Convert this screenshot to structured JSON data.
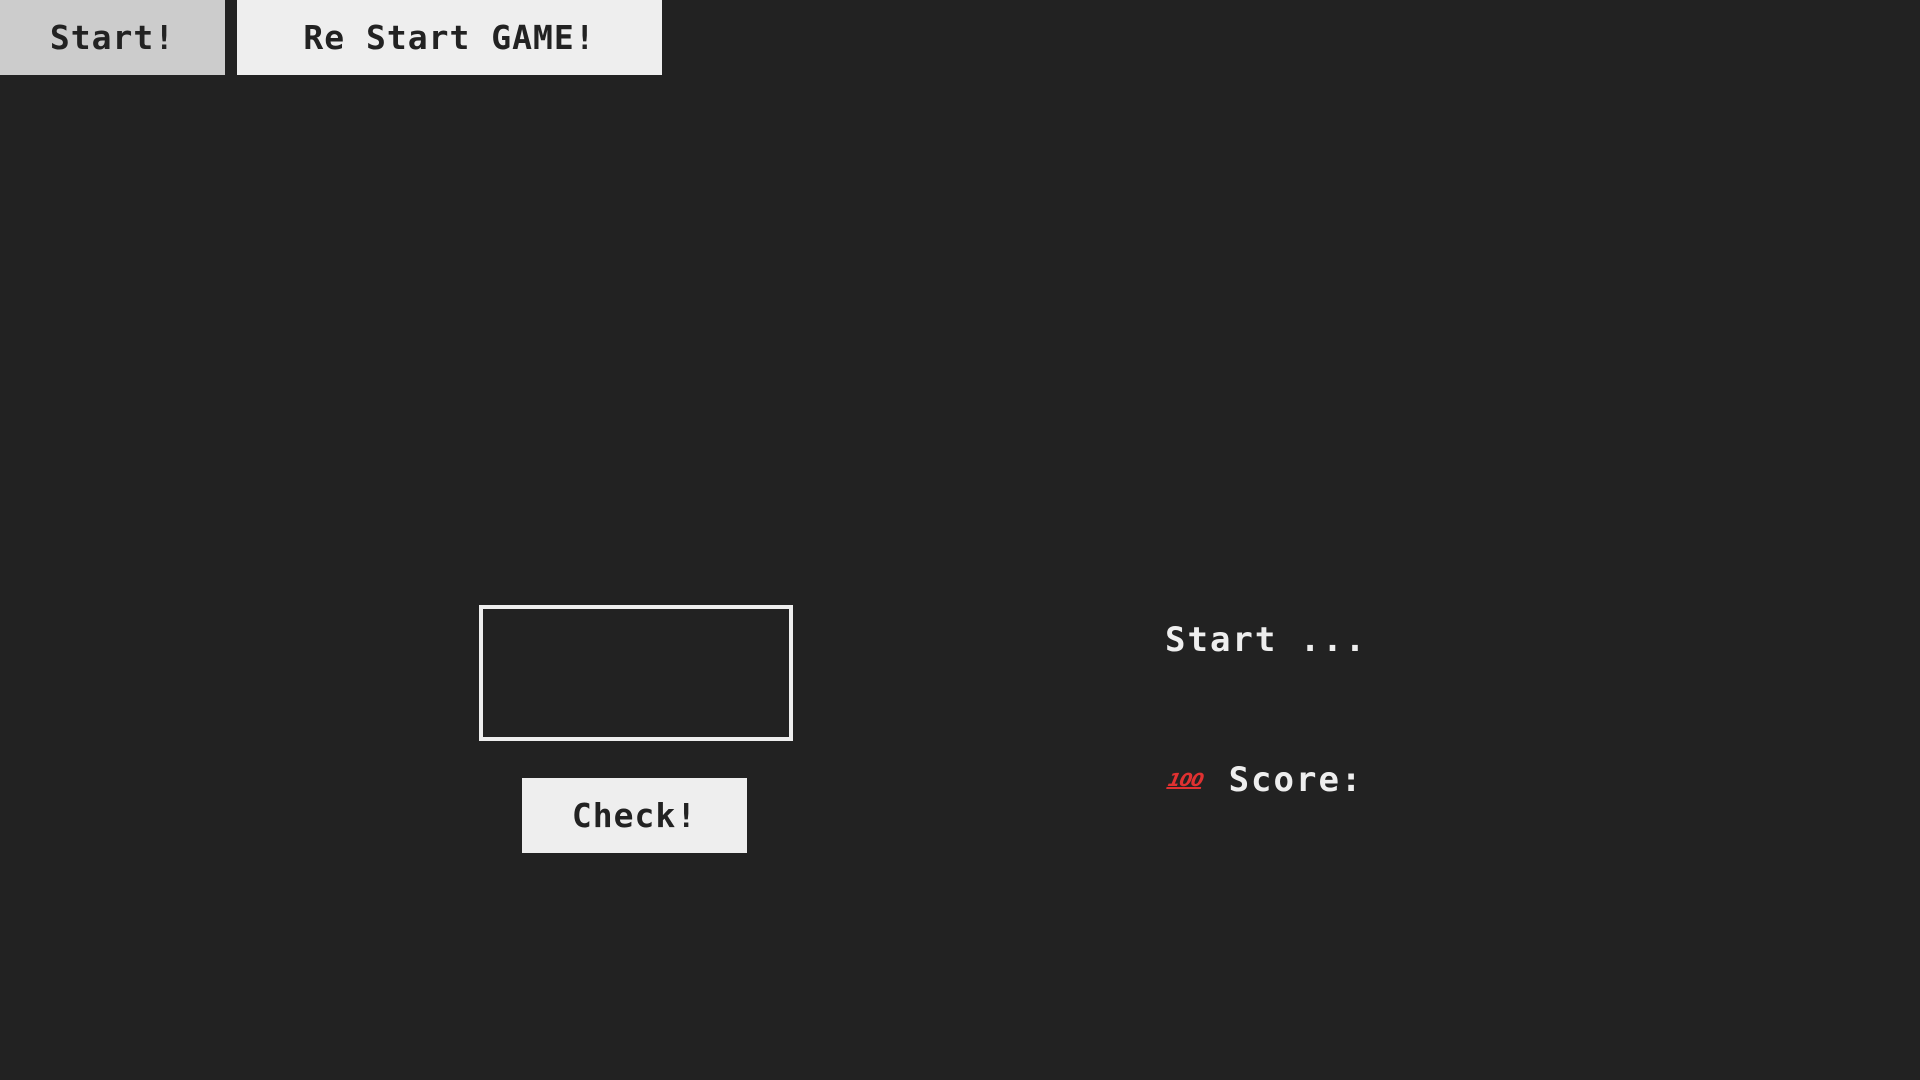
{
  "top_bar": {
    "start_label": "Start!",
    "restart_label": "Re Start GAME!"
  },
  "guess": {
    "value": "",
    "check_label": "Check!"
  },
  "status": {
    "message": "Start ...",
    "score_icon": "hundred-points-icon",
    "score_icon_glyph": "100",
    "score_label": "Score:",
    "score_value": ""
  },
  "colors": {
    "background": "#222222",
    "button": "#eeeeee",
    "button_pressed": "#cccccc",
    "text": "#eeeeee",
    "icon_red": "#e03131"
  }
}
